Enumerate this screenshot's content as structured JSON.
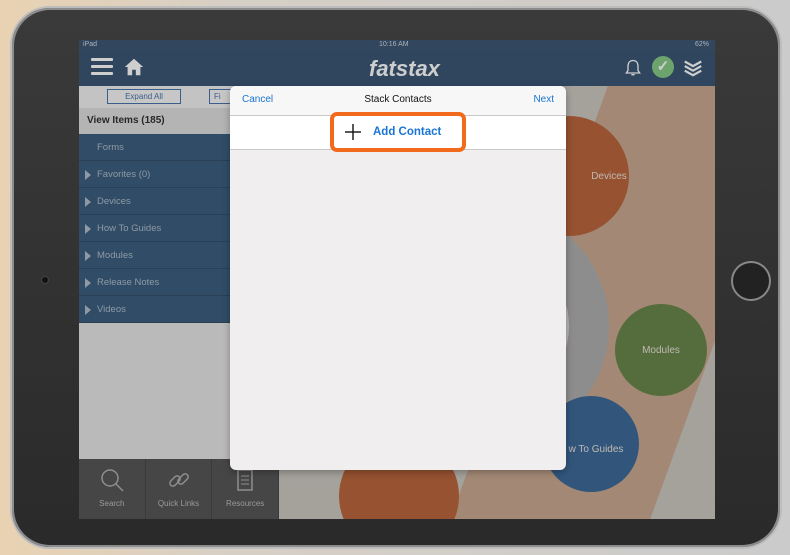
{
  "statusbar": {
    "device": "iPad",
    "time": "10:16 AM",
    "battery": "62%"
  },
  "navbar": {
    "brand": "fatstax"
  },
  "left_panel": {
    "expand_all": "Expand All",
    "filter_partial": "Fi",
    "view_items": "View Items (185)",
    "items": [
      {
        "label": "Forms",
        "arrow": false
      },
      {
        "label": "Favorites (0)",
        "arrow": true
      },
      {
        "label": "Devices",
        "arrow": true
      },
      {
        "label": "How To Guides",
        "arrow": true
      },
      {
        "label": "Modules",
        "arrow": true
      },
      {
        "label": "Release Notes",
        "arrow": true
      },
      {
        "label": "Videos",
        "arrow": true
      }
    ],
    "bottom_bar": [
      {
        "label": "Search",
        "icon": "search-icon"
      },
      {
        "label": "Quick Links",
        "icon": "link-icon"
      },
      {
        "label": "Resources",
        "icon": "document-icon"
      }
    ]
  },
  "background_circles": {
    "devices": "Devices",
    "modules": "Modules",
    "how_to_guides": "w To Guides"
  },
  "modal": {
    "cancel": "Cancel",
    "title": "Stack Contacts",
    "next": "Next",
    "add_contact": "Add Contact"
  },
  "colors": {
    "nav_blue": "#2c4a6b",
    "link_blue": "#1a74d4",
    "highlight_orange": "#f26a1b"
  }
}
